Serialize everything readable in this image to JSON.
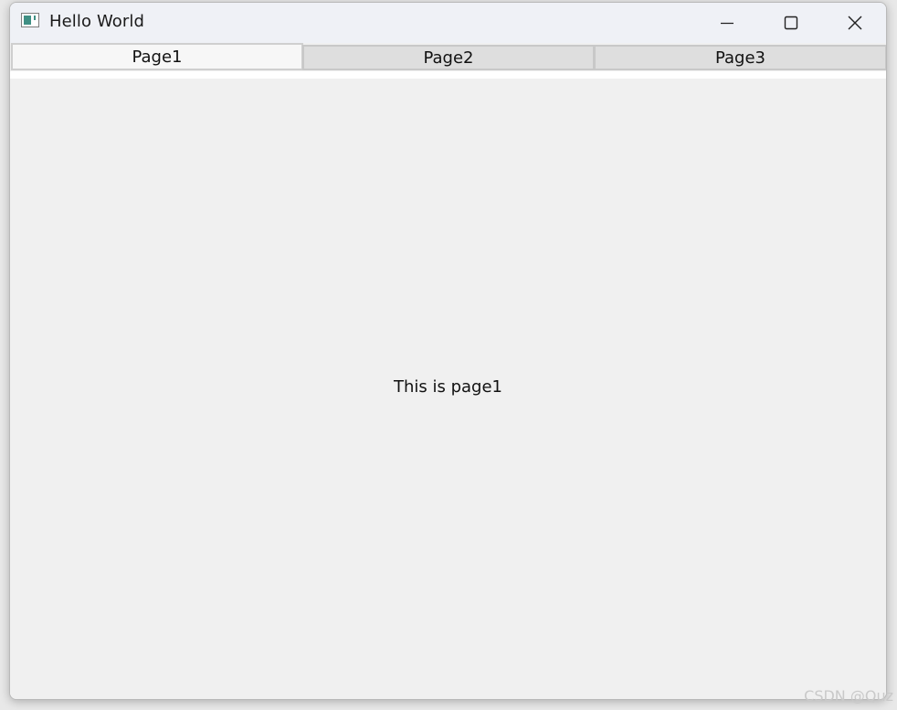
{
  "window": {
    "title": "Hello World"
  },
  "tabs": [
    {
      "label": "Page1",
      "active": true
    },
    {
      "label": "Page2",
      "active": false
    },
    {
      "label": "Page3",
      "active": false
    }
  ],
  "content": {
    "text": "This is page1"
  },
  "watermark": "CSDN @Quz",
  "icons": {
    "app": "app-window-icon",
    "minimize": "minimize-icon",
    "maximize": "maximize-icon",
    "close": "close-icon"
  },
  "colors": {
    "titlebar": "#eff1f6",
    "tab_inactive": "#dedede",
    "tab_active": "#f7f7f7",
    "content_bg": "#f0f0f0"
  }
}
